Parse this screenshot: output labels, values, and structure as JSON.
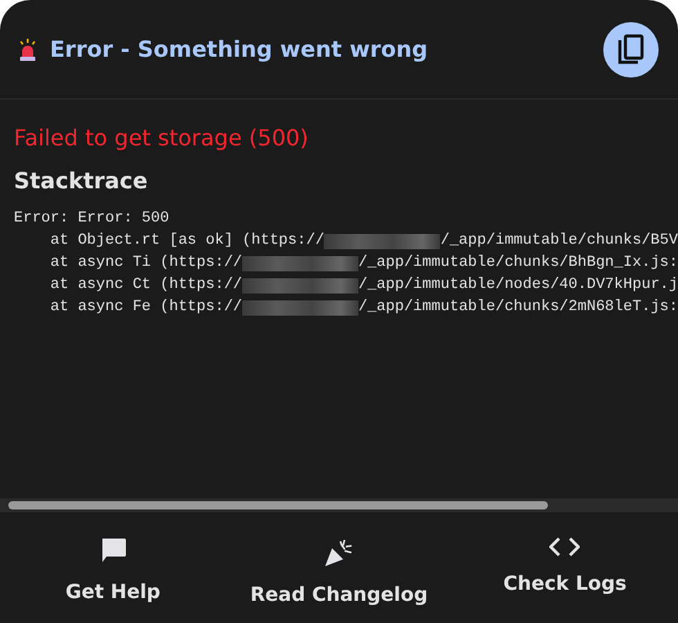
{
  "dialog": {
    "title": "Error - Something went wrong"
  },
  "error_message": "Failed to get storage (500)",
  "stacktrace": {
    "heading": "Stacktrace",
    "lines": [
      {
        "kind": "plain",
        "text": "Error: Error: 500"
      },
      {
        "kind": "redacted",
        "before": "    at Object.rt [as ok] (https://",
        "after": "/_app/immutable/chunks/B5V"
      },
      {
        "kind": "redacted",
        "before": "    at async Ti (https://",
        "after": "/_app/immutable/chunks/BhBgn_Ix.js:"
      },
      {
        "kind": "redacted",
        "before": "    at async Ct (https://",
        "after": "/_app/immutable/nodes/40.DV7kHpur.j"
      },
      {
        "kind": "redacted",
        "before": "    at async Fe (https://",
        "after": "/_app/immutable/chunks/2mN68leT.js:"
      }
    ]
  },
  "actions": [
    {
      "kind": "chat",
      "label": "Get Help"
    },
    {
      "kind": "party",
      "label": "Read Changelog"
    },
    {
      "kind": "code",
      "label": "Check Logs"
    }
  ]
}
